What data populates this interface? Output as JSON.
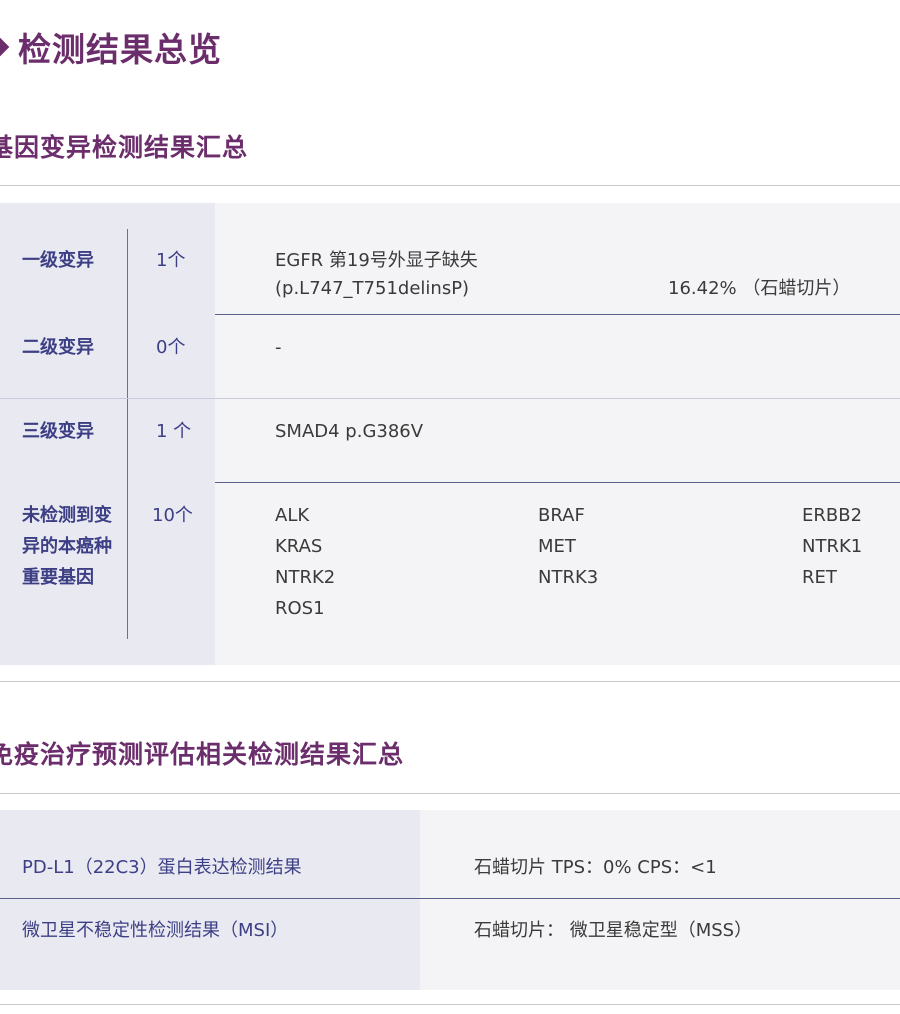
{
  "page": {
    "title": "检测结果总览"
  },
  "sections": {
    "gene": {
      "title": "基因变异检测结果汇总",
      "rows": [
        {
          "label": "一级变异",
          "count": "1个",
          "line1": "EGFR 第19号外显子缺失",
          "line2": "(p.L747_T751delinsP)",
          "freq": "16.42% （石蜡切片）"
        },
        {
          "label": "二级变异",
          "count": "0个",
          "line1": "-"
        },
        {
          "label": "三级变异",
          "count": "1 个",
          "line1": "SMAD4 p.G386V"
        }
      ],
      "undetected": {
        "label_lines": [
          "未检测到变",
          "异的本癌种",
          "重要基因"
        ],
        "count": "10个",
        "genes": [
          "ALK",
          "BRAF",
          "ERBB2",
          "KRAS",
          "MET",
          "NTRK1",
          "NTRK2",
          "NTRK3",
          "RET",
          "ROS1"
        ]
      }
    },
    "immuno": {
      "title": "免疫治疗预测评估相关检测结果汇总",
      "rows": [
        {
          "label": "PD-L1（22C3）蛋白表达检测结果",
          "value": "石蜡切片  TPS：0%    CPS：<1"
        },
        {
          "label": "微卫星不稳定性检测结果（MSI）",
          "value": "石蜡切片：  微卫星稳定型（MSS）"
        }
      ]
    }
  }
}
